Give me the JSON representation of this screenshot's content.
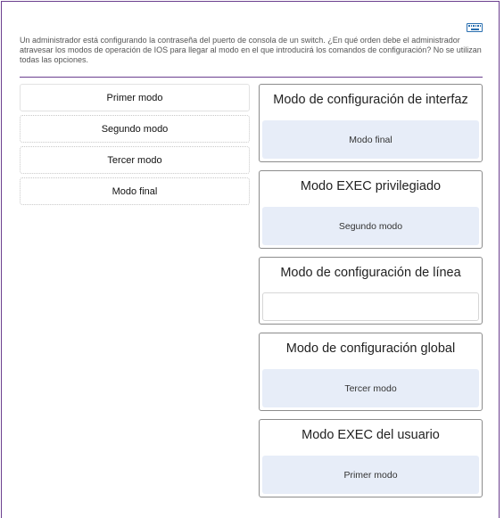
{
  "question": "Un administrador está configurando la contraseña del puerto de consola de un switch. ¿En qué orden debe el administrador atravesar los modos de operación de IOS para llegar al modo en el que introducirá los comandos de configuración? No se utilizan todas las opciones.",
  "toolbar": {
    "keyboard_icon": "keyboard-icon"
  },
  "options": [
    {
      "label": "Primer modo"
    },
    {
      "label": "Segundo modo"
    },
    {
      "label": "Tercer modo"
    },
    {
      "label": "Modo final"
    }
  ],
  "targets": [
    {
      "title": "Modo de configuración de interfaz",
      "answer": "Modo final"
    },
    {
      "title": "Modo EXEC privilegiado",
      "answer": "Segundo modo"
    },
    {
      "title": "Modo de configuración de línea",
      "answer": ""
    },
    {
      "title": "Modo de configuración global",
      "answer": "Tercer modo"
    },
    {
      "title": "Modo EXEC del usuario",
      "answer": "Primer modo"
    }
  ],
  "colors": {
    "frame": "#6b3f8f",
    "drop_fill": "#e7edf8",
    "target_border": "#8c8c8c",
    "icon_blue": "#2a6fb0"
  }
}
